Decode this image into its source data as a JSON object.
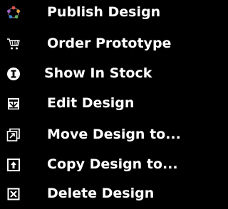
{
  "menu": {
    "items": [
      {
        "label": "Publish Design",
        "icon": "publish-icon"
      },
      {
        "label": "Order Prototype",
        "icon": "shopping-cart-icon"
      },
      {
        "label": "Show In Stock",
        "icon": "info-icon"
      },
      {
        "label": "Edit Design",
        "icon": "edit-design-icon"
      },
      {
        "label": "Move Design to...",
        "icon": "move-icon"
      },
      {
        "label": "Copy Design to...",
        "icon": "copy-icon"
      },
      {
        "label": "Delete Design",
        "icon": "delete-icon"
      }
    ]
  },
  "colors": {
    "background": "#000000",
    "text": "#ffffff",
    "publish_icon_ring": [
      "#e05050",
      "#e0a040",
      "#60b060",
      "#4080d0",
      "#a060c0"
    ]
  }
}
